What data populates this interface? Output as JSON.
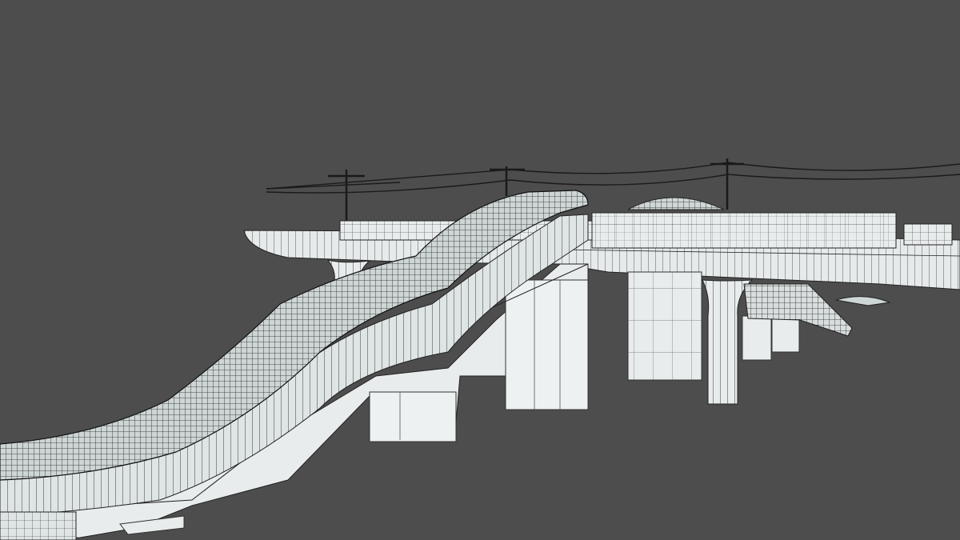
{
  "scene": {
    "background_color": "#4d4d4d",
    "wire_color": "#1a1a1a",
    "surface_color": "#e8ecec",
    "shadow_color": "#c9d1d1",
    "glass_color": "#b7c4c4"
  }
}
